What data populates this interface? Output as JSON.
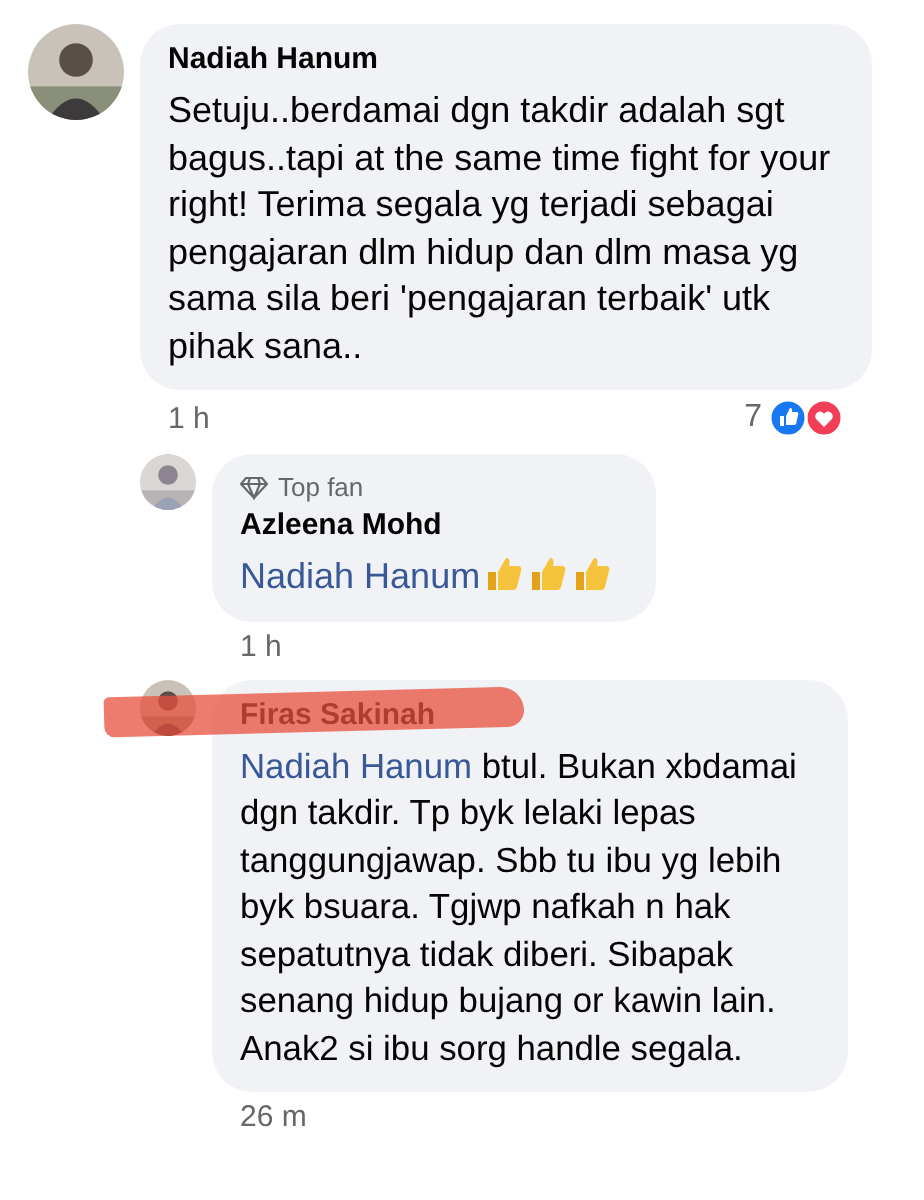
{
  "comments": [
    {
      "author": "Nadiah Hanum",
      "body": "Setuju..berdamai dgn takdir adalah sgt bagus..tapi at the same time fight for your right! Terima segala yg terjadi sebagai pengajaran dlm hidup dan dlm masa yg sama sila beri 'pengajaran terbaik' utk pihak sana..",
      "time": "1 h",
      "reaction_count": "7",
      "replies": [
        {
          "badge": "Top fan",
          "author": "Azleena Mohd",
          "mention": "Nadiah Hanum",
          "emoji": [
            {
              "kind": "thumbs_up"
            },
            {
              "kind": "thumbs_up"
            },
            {
              "kind": "thumbs_up"
            }
          ],
          "time": "1 h"
        },
        {
          "author": "Firas Sakinah",
          "mention": "Nadiah Hanum",
          "body": "btul. Bukan xbdamai dgn takdir. Tp byk lelaki lepas tanggungjawap. Sbb tu ibu yg lebih byk bsuara. Tgjwp nafkah n hak sepatutnya tidak diberi. Sibapak senang hidup bujang or kawin lain. Anak2 si ibu sorg handle segala.",
          "time": "26 m",
          "scribbled": true
        }
      ]
    }
  ]
}
